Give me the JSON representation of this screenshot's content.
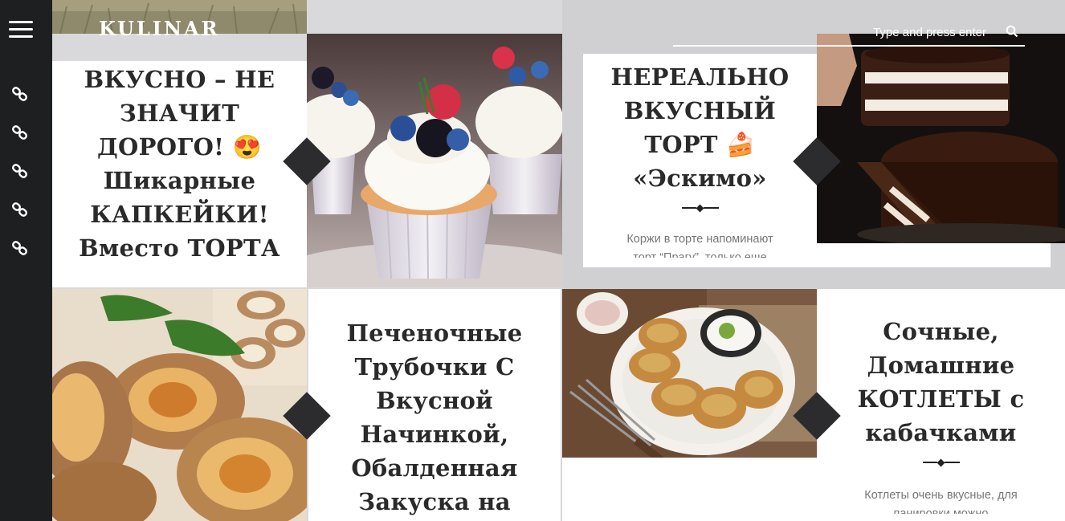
{
  "site": {
    "logo": "KULINAR",
    "search_placeholder": "Type and press enter"
  },
  "sidebar": {
    "menu_icon": "hamburger-icon",
    "links": [
      "link-icon",
      "link-icon",
      "link-icon",
      "link-icon",
      "link-icon"
    ]
  },
  "posts": [
    {
      "title": "ВКУСНО – НЕ ЗНАЧИТ ДОРОГО! 😍 Шикарные КАПКЕЙКИ! Вместо ТОРТА",
      "title_lines": [
        "ВКУСНО – НЕ",
        "ЗНАЧИТ",
        "ДОРОГО! 😍",
        "Шикарные",
        "КАПКЕЙКИ!",
        "Вместо ТОРТА"
      ],
      "image": "cupcakes"
    },
    {
      "title": "НЕРЕАЛЬНО ВКУСНЫЙ ТОРТ 🍰 «Эскимо»",
      "title_lines": [
        "НЕРЕАЛЬНО",
        "ВКУСНЫЙ",
        "ТОРТ 🍰",
        "«Эскимо»"
      ],
      "excerpt": "Коржи в торте напоминают торт “Прагу”, только еще",
      "excerpt_lines": [
        "Коржи в торте напоминают",
        "торт “Прагу”, только еще"
      ],
      "image": "chocolate-cake"
    },
    {
      "title": "Печеночные Трубочки С Вкусной Начинкой, Обалденная Закуска на",
      "title_lines": [
        "Печеночные",
        "Трубочки С",
        "Вкусной",
        "Начинкой,",
        "Обалденная",
        "Закуска на"
      ],
      "image": "liver-rolls"
    },
    {
      "title": "Сочные, Домашние КОТЛЕТЫ с кабачками",
      "title_lines": [
        "Сочные,",
        "Домашние",
        "КОТЛЕТЫ с",
        "кабачками"
      ],
      "excerpt": "Котлеты очень вкусные, для панировки можно",
      "excerpt_lines": [
        "Котлеты очень вкусные, для",
        "панировки можно"
      ],
      "image": "zucchini-cutlets"
    }
  ]
}
